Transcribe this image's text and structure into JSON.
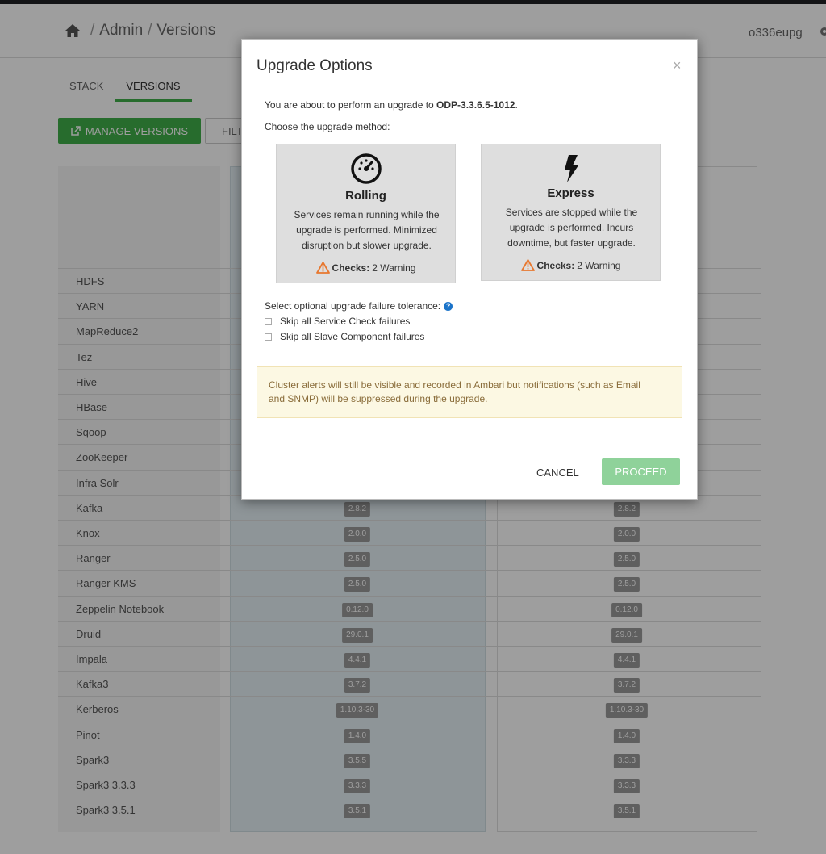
{
  "header": {
    "breadcrumb": [
      "Admin",
      "Versions"
    ],
    "breadcrumb_separator": "/",
    "username": "o336eupg"
  },
  "tabs": [
    {
      "label": "STACK",
      "active": false
    },
    {
      "label": "VERSIONS",
      "active": true
    }
  ],
  "toolbar": {
    "manage_label": "MANAGE VERSIONS",
    "filter_label": "FILT"
  },
  "services": [
    {
      "name": "HDFS"
    },
    {
      "name": "YARN"
    },
    {
      "name": "MapReduce2"
    },
    {
      "name": "Tez"
    },
    {
      "name": "Hive"
    },
    {
      "name": "HBase"
    },
    {
      "name": "Sqoop"
    },
    {
      "name": "ZooKeeper"
    },
    {
      "name": "Infra Solr"
    },
    {
      "name": "Kafka",
      "current": "2.8.2",
      "target": "2.8.2"
    },
    {
      "name": "Knox",
      "current": "2.0.0",
      "target": "2.0.0"
    },
    {
      "name": "Ranger",
      "current": "2.5.0",
      "target": "2.5.0"
    },
    {
      "name": "Ranger KMS",
      "current": "2.5.0",
      "target": "2.5.0"
    },
    {
      "name": "Zeppelin Notebook",
      "current": "0.12.0",
      "target": "0.12.0"
    },
    {
      "name": "Druid",
      "current": "29.0.1",
      "target": "29.0.1"
    },
    {
      "name": "Impala",
      "current": "4.4.1",
      "target": "4.4.1"
    },
    {
      "name": "Kafka3",
      "current": "3.7.2",
      "target": "3.7.2"
    },
    {
      "name": "Kerberos",
      "current": "1.10.3-30",
      "target": "1.10.3-30"
    },
    {
      "name": "Pinot",
      "current": "1.4.0",
      "target": "1.4.0"
    },
    {
      "name": "Spark3",
      "current": "3.5.5",
      "target": "3.3.3"
    },
    {
      "name": "Spark3 3.3.3",
      "current": "3.3.3",
      "target": "3.3.3"
    },
    {
      "name": "Spark3 3.5.1",
      "current": "3.5.1",
      "target": "3.5.1"
    }
  ],
  "modal": {
    "title": "Upgrade Options",
    "close": "×",
    "intro_prefix": "You are about to perform an upgrade to ",
    "intro_version": "ODP-3.3.6.5-1012",
    "intro_suffix": ".",
    "choose": "Choose the upgrade method:",
    "rolling": {
      "icon": "gauge-icon",
      "name": "Rolling",
      "desc": "Services remain running while the upgrade is performed. Minimized disruption but slower upgrade.",
      "checks_label": "Checks:",
      "checks_value": "2 Warning"
    },
    "express": {
      "icon": "bolt-icon",
      "name": "Express",
      "desc": "Services are stopped while the upgrade is performed. Incurs downtime, but faster upgrade.",
      "checks_label": "Checks:",
      "checks_value": "2 Warning"
    },
    "tolerance_label": "Select optional upgrade failure tolerance:",
    "skip_service_check": "Skip all Service Check failures",
    "skip_slave_failures": "Skip all Slave Component failures",
    "alert": "Cluster alerts will still be visible and recorded in Ambari but notifications (such as Email and SNMP) will be suppressed during the upgrade.",
    "cancel_label": "CANCEL",
    "proceed_label": "PROCEED"
  },
  "colors": {
    "accent_green": "#3fae49",
    "proceed_disabled": "#8fd29a",
    "warning_orange": "#e8772e",
    "help_blue": "#1a73c9"
  }
}
